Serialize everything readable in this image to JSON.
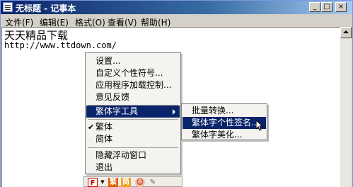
{
  "window": {
    "title": "无标题 - 记事本",
    "min_glyph": "_",
    "max_glyph": "□",
    "close_glyph": "×"
  },
  "menubar": {
    "file": "文件(F)",
    "edit": "编辑(E)",
    "format": "格式(O)",
    "view": "查看(V)",
    "help": "帮助(H)"
  },
  "editor": {
    "line1": "天天精品下载",
    "line2": "http://www.ttdown.com/"
  },
  "context_menu": {
    "settings": "设置...",
    "custom_symbols": "自定义个性符号...",
    "app_control": "应用程序加载控制...",
    "feedback": "意见反馈",
    "font_tools": "繁体字工具",
    "traditional": "繁体",
    "simplified": "简体",
    "hide_window": "隐藏浮动窗口",
    "exit": "退出",
    "check_glyph": "✔"
  },
  "submenu": {
    "batch_convert": "批量转换...",
    "signature": "繁体字个性签名...",
    "beautify": "繁体字美化..."
  },
  "toolbar": {
    "f_glyph": "F",
    "drop_glyph": "▼",
    "fan": "繁",
    "jian": "简",
    "misc1": "☺",
    "misc2": "✎"
  },
  "colors": {
    "highlight": "#0a246a",
    "title_start": "#0a246a",
    "title_end": "#a6caf0"
  }
}
